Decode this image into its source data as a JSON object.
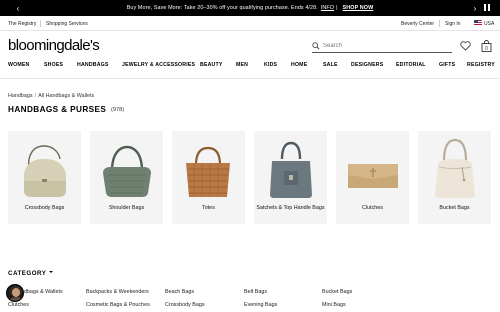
{
  "promo": {
    "text": "Buy More, Save More: Take 20–30% off your qualifying purchase. Ends 4/28.",
    "info_link": "INFO",
    "separator": "|",
    "shop_link": "SHOP NOW"
  },
  "utility": {
    "registry": "The Registry",
    "services": "Shopping Services",
    "store": "Beverly Center",
    "sign_in": "Sign In",
    "region": "USA"
  },
  "header": {
    "logo": "bloomingdale's",
    "search_placeholder": "Search"
  },
  "nav": [
    "WOMEN",
    "SHOES",
    "HANDBAGS",
    "JEWELRY & ACCESSORIES",
    "BEAUTY",
    "MEN",
    "KIDS",
    "HOME",
    "SALE",
    "DESIGNERS",
    "EDITORIAL",
    "GIFTS",
    "REGISTRY"
  ],
  "breadcrumb": {
    "home": "Handbags",
    "separator": "/",
    "current": "All Handbags & Wallets"
  },
  "page": {
    "title": "HANDBAGS & PURSES",
    "count": "(978)"
  },
  "tiles": [
    {
      "label": "Crossbody Bags",
      "icon": "crossbody-bag-image"
    },
    {
      "label": "Shoulder Bags",
      "icon": "shoulder-bag-image"
    },
    {
      "label": "Totes",
      "icon": "tote-bag-image"
    },
    {
      "label": "Satchels & Top Handle Bags",
      "icon": "satchel-bag-image"
    },
    {
      "label": "Clutches",
      "icon": "clutch-bag-image"
    },
    {
      "label": "Bucket Bags",
      "icon": "bucket-bag-image"
    }
  ],
  "category": {
    "heading": "CATEGORY",
    "links": [
      "Handbags & Wallets",
      "Backpacks & Weekenders",
      "Beach Bags",
      "Belt Bags",
      "Bucket Bags",
      "Clutches",
      "Cosmetic Bags & Pouches",
      "Crossbody Bags",
      "Evening Bags",
      "Mini Bags"
    ]
  },
  "colors": {
    "promo_bg": "#000000",
    "tile_bg": "#f4f4f4",
    "text": "#000000"
  }
}
